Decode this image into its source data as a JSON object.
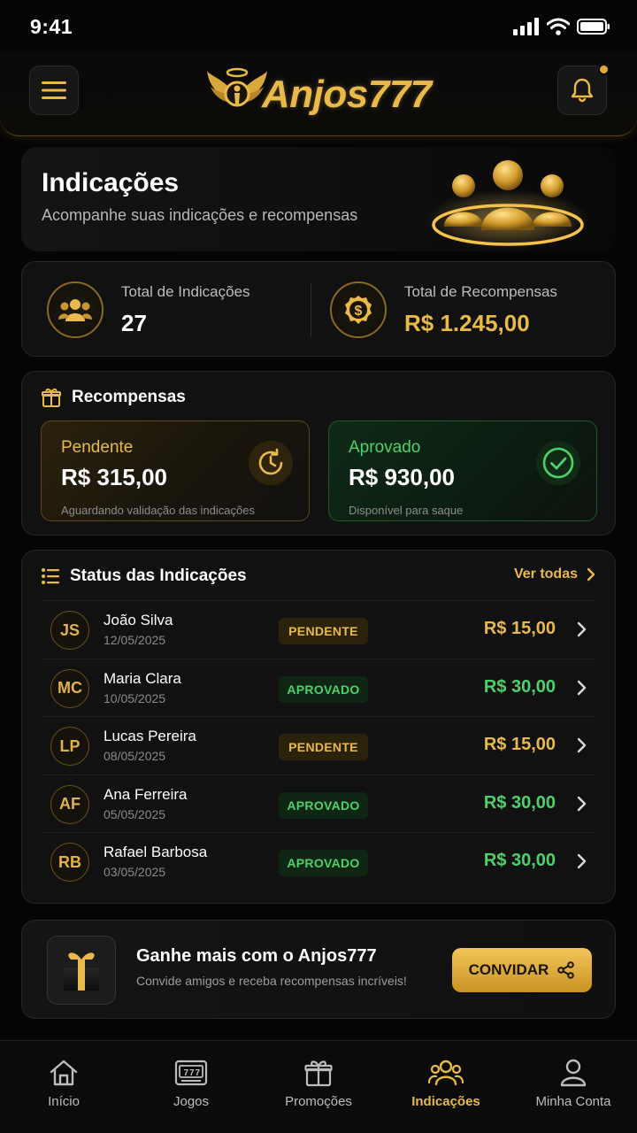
{
  "status_bar": {
    "time": "9:41"
  },
  "header": {
    "logo_text": "Anjos777",
    "menu_icon": "hamburger-icon",
    "bell_icon": "bell-icon",
    "has_notification": true
  },
  "hero": {
    "title": "Indicações",
    "subtitle": "Acompanhe suas indicações e recompensas"
  },
  "stats": {
    "referrals": {
      "label": "Total de Indicações",
      "value": "27",
      "icon": "users-icon"
    },
    "rewards": {
      "label": "Total de Recompensas",
      "value": "R$ 1.245,00",
      "icon": "money-coin-icon"
    }
  },
  "rewards": {
    "title": "Recompensas",
    "pending": {
      "label": "Pendente",
      "value": "R$ 315,00",
      "note": "Aguardando validação das indicações",
      "icon": "clock-icon"
    },
    "approved": {
      "label": "Aprovado",
      "value": "R$ 930,00",
      "note": "Disponível para saque",
      "icon": "check-circle-icon"
    }
  },
  "status_list": {
    "title": "Status das Indicações",
    "see_all": "Ver todas",
    "rows": [
      {
        "initials": "JS",
        "name": "João Silva",
        "date": "12/05/2025",
        "status": "PENDENTE",
        "amount": "R$ 15,00"
      },
      {
        "initials": "MC",
        "name": "Maria Clara",
        "date": "10/05/2025",
        "status": "APROVADO",
        "amount": "R$ 30,00"
      },
      {
        "initials": "LP",
        "name": "Lucas Pereira",
        "date": "08/05/2025",
        "status": "PENDENTE",
        "amount": "R$ 15,00"
      },
      {
        "initials": "AF",
        "name": "Ana Ferreira",
        "date": "05/05/2025",
        "status": "APROVADO",
        "amount": "R$ 30,00"
      },
      {
        "initials": "RB",
        "name": "Rafael Barbosa",
        "date": "03/05/2025",
        "status": "APROVADO",
        "amount": "R$ 30,00"
      }
    ]
  },
  "promo": {
    "title": "Ganhe mais com o Anjos777",
    "subtitle": "Convide amigos e receba recompensas incríveis!",
    "button": "CONVIDAR"
  },
  "nav": {
    "items": [
      {
        "label": "Início",
        "icon": "home-icon"
      },
      {
        "label": "Jogos",
        "icon": "slot-machine-icon"
      },
      {
        "label": "Promoções",
        "icon": "gift-icon"
      },
      {
        "label": "Indicações",
        "icon": "users-icon",
        "active": true
      },
      {
        "label": "Minha Conta",
        "icon": "user-icon"
      }
    ]
  },
  "colors": {
    "gold": "#e9b94a",
    "green": "#4fd16a",
    "background": "#050505"
  }
}
